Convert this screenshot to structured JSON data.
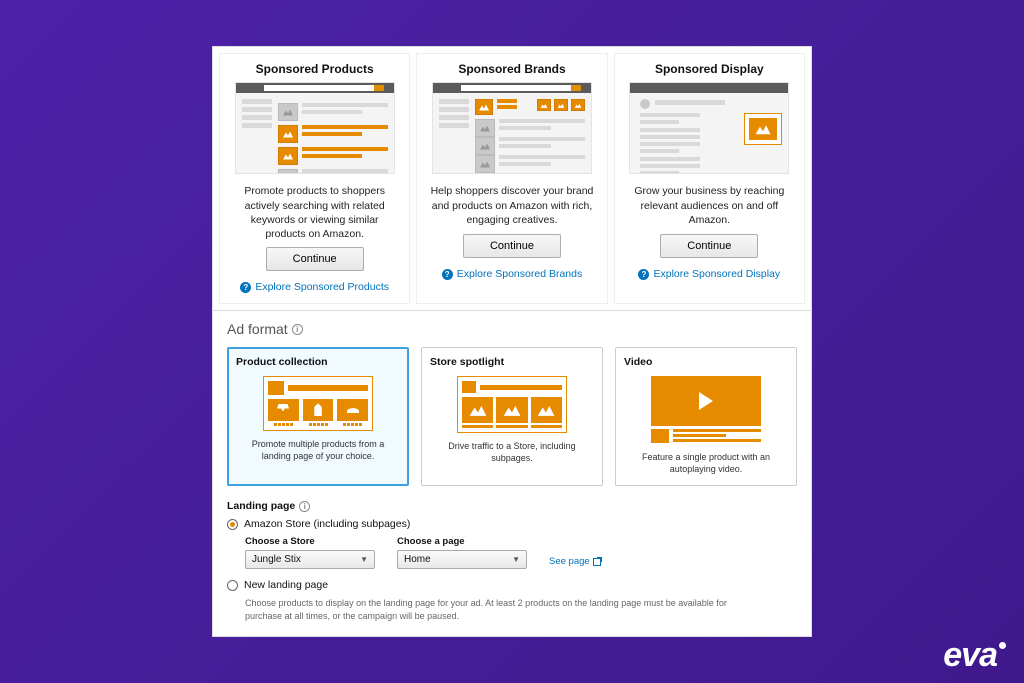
{
  "campaign_types": [
    {
      "title": "Sponsored Products",
      "desc": "Promote products to shoppers actively searching with related keywords or viewing similar products on Amazon.",
      "button": "Continue",
      "link": "Explore Sponsored Products"
    },
    {
      "title": "Sponsored Brands",
      "desc": "Help shoppers discover your brand and products on Amazon with rich, engaging creatives.",
      "button": "Continue",
      "link": "Explore Sponsored Brands"
    },
    {
      "title": "Sponsored Display",
      "desc": "Grow your business by reaching relevant audiences on and off Amazon.",
      "button": "Continue",
      "link": "Explore Sponsored Display"
    }
  ],
  "ad_format": {
    "section_title": "Ad format",
    "options": [
      {
        "title": "Product collection",
        "desc": "Promote multiple products from a landing page of your choice.",
        "selected": true
      },
      {
        "title": "Store spotlight",
        "desc": "Drive traffic to a Store, including subpages.",
        "selected": false
      },
      {
        "title": "Video",
        "desc": "Feature a single product with an autoplaying video.",
        "selected": false
      }
    ]
  },
  "landing": {
    "section_title": "Landing page",
    "radio_amazon_store": "Amazon Store (including subpages)",
    "radio_new_page": "New landing page",
    "choose_store_label": "Choose a Store",
    "choose_store_value": "Jungle Stix",
    "choose_page_label": "Choose a page",
    "choose_page_value": "Home",
    "see_page": "See page",
    "helper": "Choose products to display on the landing page for your ad. At least 2 products on the landing page must be available for purchase at all times, or the campaign will be paused."
  },
  "brand": "eva"
}
